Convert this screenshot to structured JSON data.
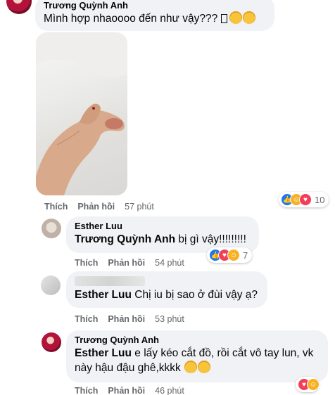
{
  "comment1": {
    "author": "Trương Quỳnh Anh",
    "text": "Mình hợp nhaoooo đến như vậy???",
    "actions": {
      "like": "Thích",
      "reply": "Phản hồi",
      "time": "57 phút"
    },
    "reactions": {
      "count": "10",
      "icons": [
        "like-icon",
        "care-icon",
        "love-icon"
      ]
    }
  },
  "reply1": {
    "author": "Esther Luu",
    "mention": "Trương Quỳnh Anh",
    "text": "bị gì vậy!!!!!!!!!",
    "actions": {
      "like": "Thích",
      "reply": "Phản hồi",
      "time": "54 phút"
    },
    "reactions": {
      "count": "7",
      "icons": [
        "like-icon",
        "love-icon",
        "care-icon"
      ]
    }
  },
  "reply2": {
    "mention": "Esther Luu",
    "text": "Chị iu bị sao ở đùi vậy ạ?",
    "actions": {
      "like": "Thích",
      "reply": "Phản hồi",
      "time": "53 phút"
    }
  },
  "reply3": {
    "author": "Trương Quỳnh Anh",
    "mention": "Esther Luu",
    "text": "e lấy kéo cắt đồ, rồi cắt vô tay lun, vk này hậu đậu ghê,kkkk",
    "actions": {
      "like": "Thích",
      "reply": "Phản hồi",
      "time": "46 phút"
    },
    "reactions": {
      "icons": [
        "love-icon",
        "care-icon"
      ]
    }
  },
  "colors": {
    "bubble": "#f0f2f5",
    "meta": "#65676b",
    "like": "#1877f2",
    "love": "#f33e58",
    "care": "#f7b125"
  }
}
